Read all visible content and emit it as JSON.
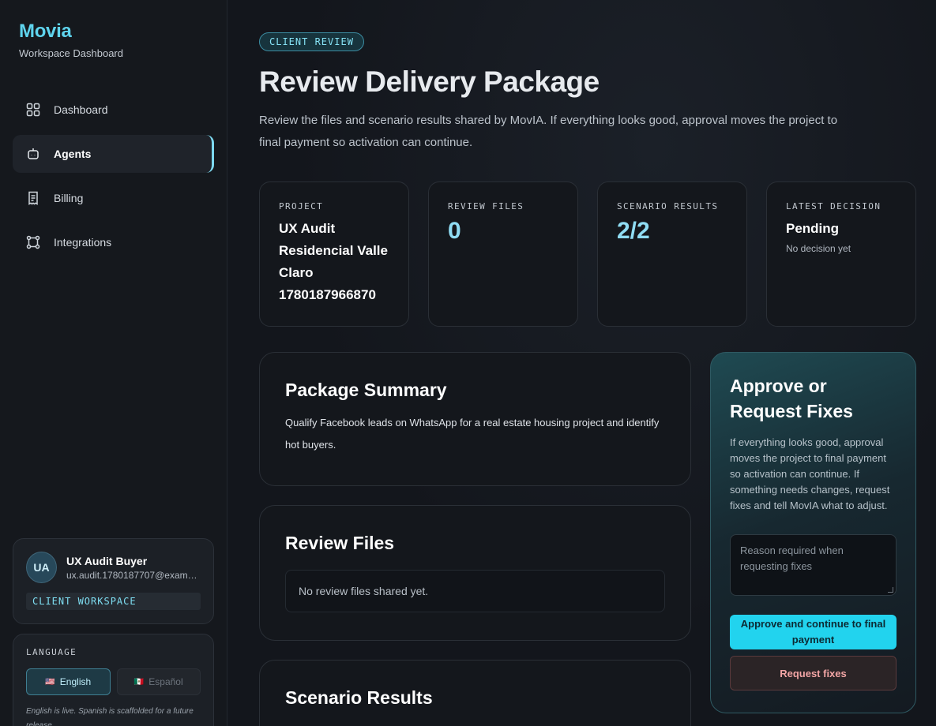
{
  "brand": {
    "title": "Movia",
    "subtitle": "Workspace Dashboard"
  },
  "nav": [
    {
      "label": "Dashboard",
      "icon": "grid-icon",
      "active": false
    },
    {
      "label": "Agents",
      "icon": "bot-icon",
      "active": true
    },
    {
      "label": "Billing",
      "icon": "receipt-icon",
      "active": false
    },
    {
      "label": "Integrations",
      "icon": "network-icon",
      "active": false
    }
  ],
  "user": {
    "initials": "UA",
    "name": "UX Audit Buyer",
    "email": "ux.audit.1780187707@exampl...",
    "workspace_badge": "CLIENT WORKSPACE"
  },
  "language": {
    "label": "LANGUAGE",
    "english": "English",
    "spanish": "Español",
    "english_flag": "🇺🇸",
    "spanish_flag": "🇲🇽",
    "note": "English is live. Spanish is scaffolded for a future release."
  },
  "header": {
    "eyebrow": "CLIENT REVIEW",
    "title": "Review Delivery Package",
    "description": "Review the files and scenario results shared by MovIA. If everything looks good, approval moves the project to final payment so activation can continue."
  },
  "stats": {
    "project": {
      "label": "PROJECT",
      "value": "UX Audit Residencial Valle Claro 1780187966870"
    },
    "review_files": {
      "label": "REVIEW FILES",
      "value": "0"
    },
    "scenario_results": {
      "label": "SCENARIO RESULTS",
      "value": "2/2"
    },
    "latest_decision": {
      "label": "LATEST DECISION",
      "value": "Pending",
      "sub": "No decision yet"
    }
  },
  "package_summary": {
    "title": "Package Summary",
    "text": "Qualify Facebook leads on WhatsApp for a real estate housing project and identify hot buyers."
  },
  "review_files": {
    "title": "Review Files",
    "empty": "No review files shared yet."
  },
  "scenario_results": {
    "title": "Scenario Results"
  },
  "approval": {
    "title": "Approve or Request Fixes",
    "text": "If everything looks good, approval moves the project to final payment so activation can continue. If something needs changes, request fixes and tell MovIA what to adjust.",
    "reason_placeholder": "Reason required when requesting fixes",
    "approve_label": "Approve and continue to final payment",
    "fix_label": "Request fixes"
  },
  "colors": {
    "accent": "#22d3ee",
    "brand": "#5fd4ee",
    "danger": "#f2a5a5"
  }
}
